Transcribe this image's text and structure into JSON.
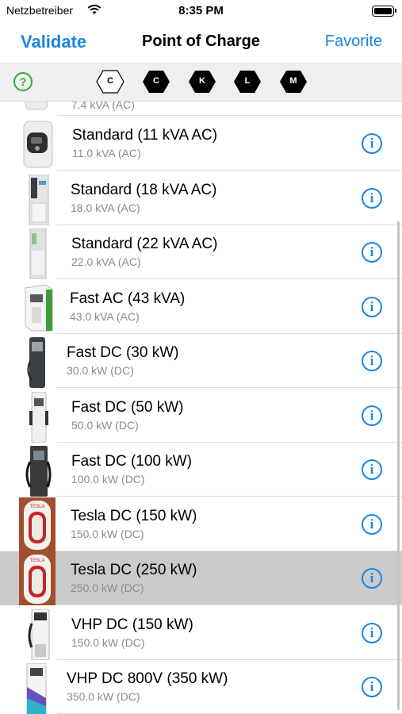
{
  "status": {
    "carrier": "Netzbetreiber",
    "time": "8:35 PM"
  },
  "nav": {
    "left": "Validate",
    "title": "Point of Charge",
    "right": "Favorite"
  },
  "filters": {
    "help": "?",
    "chips": [
      "C",
      "C",
      "K",
      "L",
      "M"
    ]
  },
  "list": {
    "partial_sub": "7.4 kVA (AC)",
    "items": [
      {
        "name": "Standard (11 kVA AC)",
        "sub": "11.0 kVA (AC)"
      },
      {
        "name": "Standard (18 kVA AC)",
        "sub": "18.0 kVA (AC)"
      },
      {
        "name": "Standard (22 kVA AC)",
        "sub": "22.0 kVA (AC)"
      },
      {
        "name": "Fast AC (43 kVA)",
        "sub": "43.0 kVA (AC)"
      },
      {
        "name": "Fast DC (30 kW)",
        "sub": "30.0 kW (DC)"
      },
      {
        "name": "Fast DC (50 kW)",
        "sub": "50.0 kW (DC)"
      },
      {
        "name": "Fast DC (100 kW)",
        "sub": "100.0 kW (DC)"
      },
      {
        "name": "Tesla DC (150 kW)",
        "sub": "150.0 kW (DC)",
        "thumb_label": "TESLA"
      },
      {
        "name": "Tesla DC (250 kW)",
        "sub": "250.0 kW (DC)",
        "thumb_label": "TESLA"
      },
      {
        "name": "VHP DC (150 kW)",
        "sub": "150.0 kW (DC)"
      },
      {
        "name": "VHP DC 800V (350 kW)",
        "sub": "350.0 kW (DC)"
      }
    ],
    "info_glyph": "i",
    "selected_index": 8
  },
  "colors": {
    "accent": "#1a86e6",
    "help": "#2eaa2e",
    "selected_row": "#cacaca"
  }
}
